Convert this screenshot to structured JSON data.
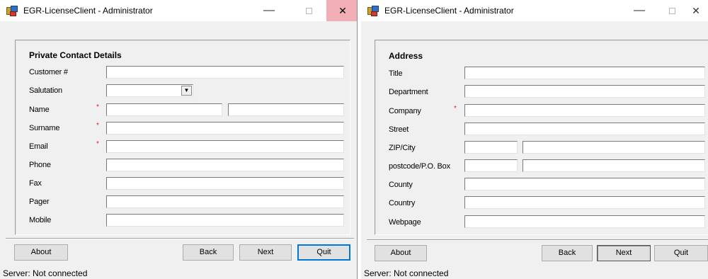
{
  "left_window": {
    "title": "EGR-LicenseClient - Administrator",
    "section_title": "Private Contact Details",
    "fields": [
      {
        "label": "Customer #",
        "required": false,
        "value": ""
      },
      {
        "label": "Salutation",
        "required": false,
        "value": ""
      },
      {
        "label": "Name",
        "required": true,
        "value": "",
        "value2": ""
      },
      {
        "label": "Surname",
        "required": true,
        "value": ""
      },
      {
        "label": "Email",
        "required": true,
        "value": ""
      },
      {
        "label": "Phone",
        "required": false,
        "value": ""
      },
      {
        "label": "Fax",
        "required": false,
        "value": ""
      },
      {
        "label": "Pager",
        "required": false,
        "value": ""
      },
      {
        "label": "Mobile",
        "required": false,
        "value": ""
      }
    ],
    "buttons": {
      "about": "About",
      "back": "Back",
      "next": "Next",
      "quit": "Quit"
    },
    "status": "Server:  Not connected"
  },
  "right_window": {
    "title": "EGR-LicenseClient - Administrator",
    "section_title": "Address",
    "fields": [
      {
        "label": "Title",
        "required": false,
        "value": ""
      },
      {
        "label": "Department",
        "required": false,
        "value": ""
      },
      {
        "label": "Company",
        "required": true,
        "value": ""
      },
      {
        "label": "Street",
        "required": false,
        "value": ""
      },
      {
        "label": "ZIP/City",
        "required": false,
        "value": "",
        "value2": ""
      },
      {
        "label": "postcode/P.O. Box",
        "required": false,
        "value": "",
        "value2": ""
      },
      {
        "label": "County",
        "required": false,
        "value": ""
      },
      {
        "label": "Country",
        "required": false,
        "value": ""
      },
      {
        "label": "Webpage",
        "required": false,
        "value": ""
      }
    ],
    "buttons": {
      "about": "About",
      "back": "Back",
      "next": "Next",
      "quit": "Quit"
    },
    "status": "Server:  Not connected"
  },
  "icons": {
    "app": "egr-license-client-icon",
    "minimize": "minimize-icon",
    "maximize": "maximize-icon",
    "close": "close-icon",
    "dropdown": "chevron-down-icon"
  },
  "glyphs": {
    "minimize": "—",
    "close": "✕",
    "dropdown": "▼",
    "required": "*"
  },
  "colors": {
    "window_bg": "#f0f0f0",
    "titlebar_bg": "#ffffff",
    "close_hover": "#f1aeb5",
    "required_marker": "#e2232a",
    "default_button_border": "#0078d7"
  }
}
